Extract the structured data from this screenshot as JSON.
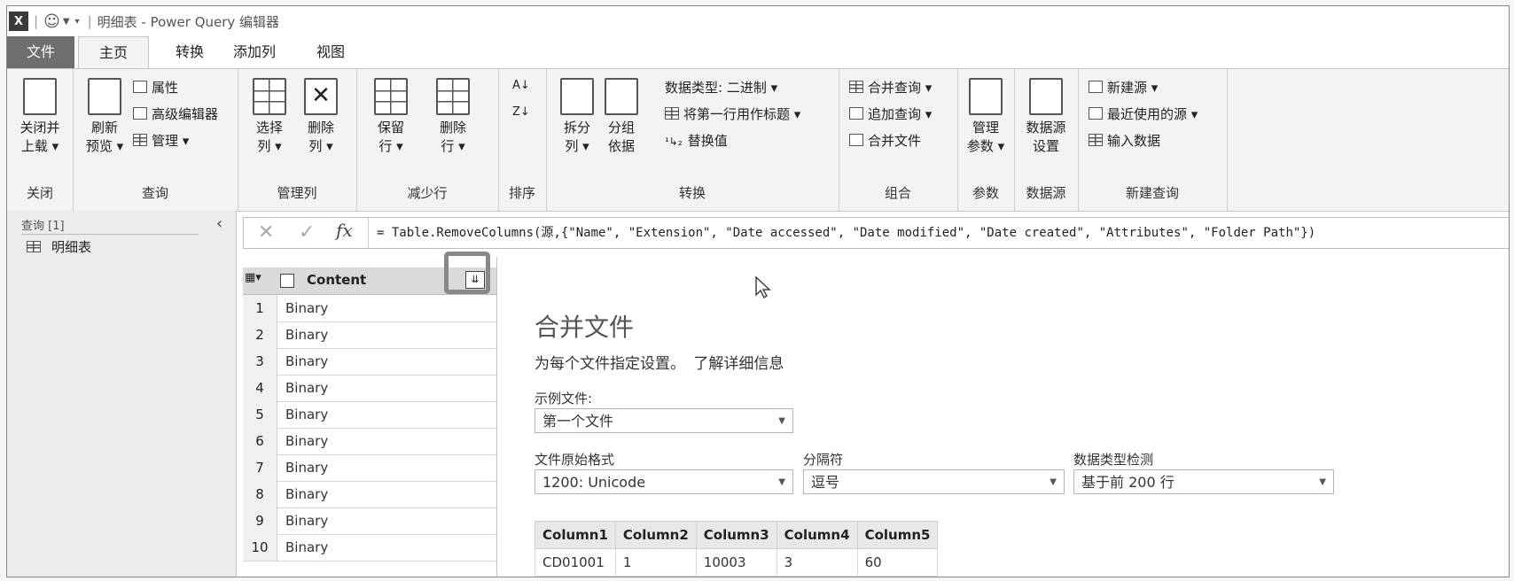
{
  "titlebar": {
    "app_icon": "X",
    "title": "明细表 - Power Query 编辑器"
  },
  "tabs": [
    "文件",
    "主页",
    "转换",
    "添加列",
    "视图"
  ],
  "ribbon": {
    "close": {
      "button": "关闭并上载 ▾",
      "line1": "关闭并",
      "line2": "上载 ▾",
      "group": "关闭"
    },
    "query": {
      "refresh1": "刷新",
      "refresh2": "预览 ▾",
      "properties": "属性",
      "advanced_editor": "高级编辑器",
      "manage": "管理 ▾",
      "group": "查询"
    },
    "manage_cols": {
      "choose1": "选择",
      "choose2": "列 ▾",
      "remove1": "删除",
      "remove2": "列 ▾",
      "group": "管理列"
    },
    "reduce_rows": {
      "keep1": "保留",
      "keep2": "行 ▾",
      "remove1": "删除",
      "remove2": "行 ▾",
      "group": "减少行"
    },
    "sort": {
      "group": "排序"
    },
    "transform": {
      "split1": "拆分",
      "split2": "列 ▾",
      "group1": "分组",
      "group2": "依据",
      "data_type": "数据类型: 二进制 ▾",
      "first_row_header": "将第一行用作标题 ▾",
      "replace": "替换值",
      "group": "转换"
    },
    "combine": {
      "merge": "合并查询 ▾",
      "append": "追加查询 ▾",
      "combine_files": "合并文件",
      "group": "组合"
    },
    "params": {
      "manage1": "管理",
      "manage2": "参数 ▾",
      "group": "参数"
    },
    "datasource": {
      "settings1": "数据源",
      "settings2": "设置",
      "group": "数据源"
    },
    "new_query": {
      "new_source": "新建源 ▾",
      "recent": "最近使用的源 ▾",
      "enter_data": "输入数据",
      "group": "新建查询"
    }
  },
  "queries_pane": {
    "header": "查询 [1]",
    "items": [
      "明细表"
    ]
  },
  "formula_bar": {
    "formula": "= Table.RemoveColumns(源,{\"Name\", \"Extension\", \"Date accessed\", \"Date modified\", \"Date created\", \"Attributes\", \"Folder Path\"})"
  },
  "grid": {
    "column": "Content",
    "rows": [
      {
        "n": "1",
        "v": "Binary"
      },
      {
        "n": "2",
        "v": "Binary"
      },
      {
        "n": "3",
        "v": "Binary"
      },
      {
        "n": "4",
        "v": "Binary"
      },
      {
        "n": "5",
        "v": "Binary"
      },
      {
        "n": "6",
        "v": "Binary"
      },
      {
        "n": "7",
        "v": "Binary"
      },
      {
        "n": "8",
        "v": "Binary"
      },
      {
        "n": "9",
        "v": "Binary"
      },
      {
        "n": "10",
        "v": "Binary"
      }
    ]
  },
  "combine_panel": {
    "title": "合并文件",
    "description": "为每个文件指定设置。",
    "learn_more": "了解详细信息",
    "sample_file_label": "示例文件:",
    "sample_file_value": "第一个文件",
    "origin_label": "文件原始格式",
    "origin_value": "1200: Unicode",
    "delimiter_label": "分隔符",
    "delimiter_value": "逗号",
    "detection_label": "数据类型检测",
    "detection_value": "基于前 200 行",
    "preview": {
      "headers": [
        "Column1",
        "Column2",
        "Column3",
        "Column4",
        "Column5"
      ],
      "rows": [
        [
          "CD01001",
          "1",
          "10003",
          "3",
          "60"
        ]
      ]
    }
  }
}
